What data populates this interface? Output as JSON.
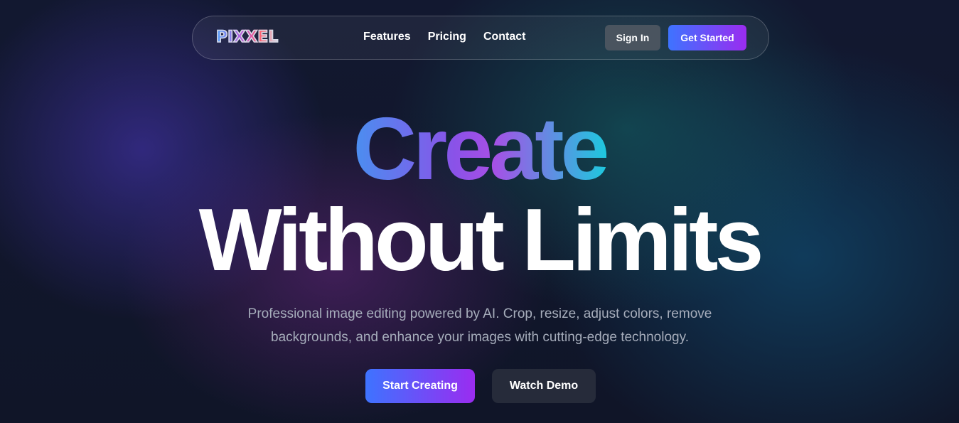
{
  "nav": {
    "logo_text": "PIXXEL",
    "links": [
      {
        "label": "Features"
      },
      {
        "label": "Pricing"
      },
      {
        "label": "Contact"
      }
    ],
    "sign_in_label": "Sign In",
    "get_started_label": "Get Started"
  },
  "hero": {
    "headline_line1": "Create",
    "headline_line2": "Without Limits",
    "subtitle": "Professional image editing powered by AI. Crop, resize, adjust colors, remove backgrounds, and enhance your images with cutting-edge technology.",
    "primary_cta": "Start Creating",
    "secondary_cta": "Watch Demo"
  },
  "colors": {
    "background": "#0f1425",
    "accent_start": "#3e73ff",
    "accent_end": "#9a2cf0",
    "headline_gradient_end": "#1ec8de"
  }
}
